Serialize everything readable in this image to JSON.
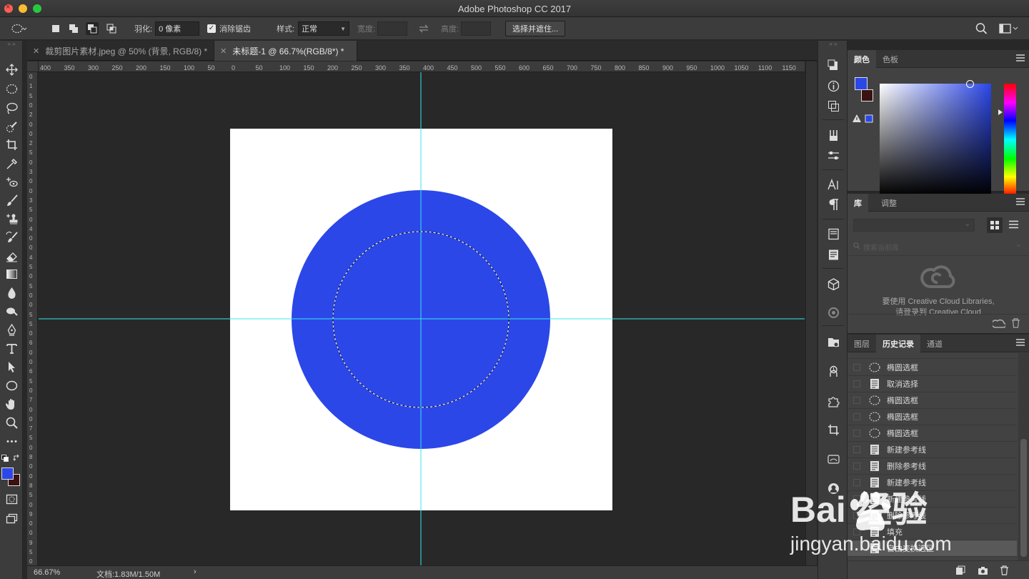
{
  "window": {
    "title": "Adobe Photoshop CC 2017"
  },
  "options_bar": {
    "feather_label": "羽化:",
    "feather_value": "0 像素",
    "antialias_label": "消除锯齿",
    "style_label": "样式:",
    "style_value": "正常",
    "width_label": "宽度:",
    "height_label": "高度:",
    "refine_button": "选择并遮住..."
  },
  "tabs": [
    {
      "label": "裁剪图片素材.jpeg @ 50% (背景, RGB/8) *",
      "active": false
    },
    {
      "label": "未标题-1 @ 66.7%(RGB/8*) *",
      "active": true
    }
  ],
  "ruler": {
    "h_ticks": [
      "400",
      "350",
      "300",
      "250",
      "200",
      "150",
      "100",
      "50",
      "0",
      "50",
      "100",
      "150",
      "200",
      "250",
      "300",
      "350",
      "400",
      "450",
      "500",
      "550",
      "600",
      "650",
      "700",
      "750",
      "800",
      "850",
      "900",
      "950",
      "1000",
      "1050",
      "1100",
      "1150"
    ],
    "v_ticks": [
      "0",
      "1",
      "5",
      "0",
      "2",
      "0",
      "0",
      "2",
      "5",
      "0",
      "3",
      "0",
      "0",
      "3",
      "5",
      "0",
      "4",
      "0",
      "0",
      "4",
      "5",
      "0",
      "5",
      "0",
      "0",
      "5",
      "5",
      "0",
      "6",
      "0",
      "0",
      "6",
      "5",
      "0",
      "7",
      "0",
      "0",
      "7",
      "5",
      "0",
      "8",
      "0",
      "0",
      "8",
      "5",
      "0",
      "9",
      "0",
      "0",
      "9",
      "5",
      "0"
    ]
  },
  "status_bar": {
    "zoom": "66.67%",
    "doc_info": "文档:1.83M/1.50M",
    "arrow": "›"
  },
  "color_panel": {
    "tabs": [
      "颜色",
      "色板"
    ],
    "foreground": "#2b47e8",
    "background": "#3a1212"
  },
  "library_panel": {
    "tabs": [
      "库",
      "调整"
    ],
    "search_placeholder": "搜索当前库",
    "message_line1": "要使用 Creative Cloud Libraries,",
    "message_line2": "请登录到 Creative Cloud"
  },
  "history_panel": {
    "tabs": [
      "图层",
      "历史记录",
      "通道"
    ],
    "items": [
      {
        "icon": "ellipse-marquee-icon",
        "label": "椭圆选框"
      },
      {
        "icon": "doc-icon",
        "label": "取消选择"
      },
      {
        "icon": "ellipse-marquee-icon",
        "label": "椭圆选框"
      },
      {
        "icon": "ellipse-marquee-icon",
        "label": "椭圆选框"
      },
      {
        "icon": "ellipse-marquee-icon",
        "label": "椭圆选框"
      },
      {
        "icon": "doc-icon",
        "label": "新建参考线"
      },
      {
        "icon": "doc-icon",
        "label": "删除参考线"
      },
      {
        "icon": "doc-icon",
        "label": "新建参考线"
      },
      {
        "icon": "doc-icon",
        "label": "新建参考线"
      },
      {
        "icon": "doc-icon",
        "label": "删除参考线"
      },
      {
        "icon": "doc-icon",
        "label": "填充"
      },
      {
        "icon": "doc-icon",
        "label": "自由变换选区"
      }
    ]
  },
  "watermark": {
    "brand": "Bai  经验",
    "url": "jingyan.baidu.com"
  },
  "canvas": {
    "fill_color": "#2b47e8",
    "guide_color": "#35e8f0"
  }
}
